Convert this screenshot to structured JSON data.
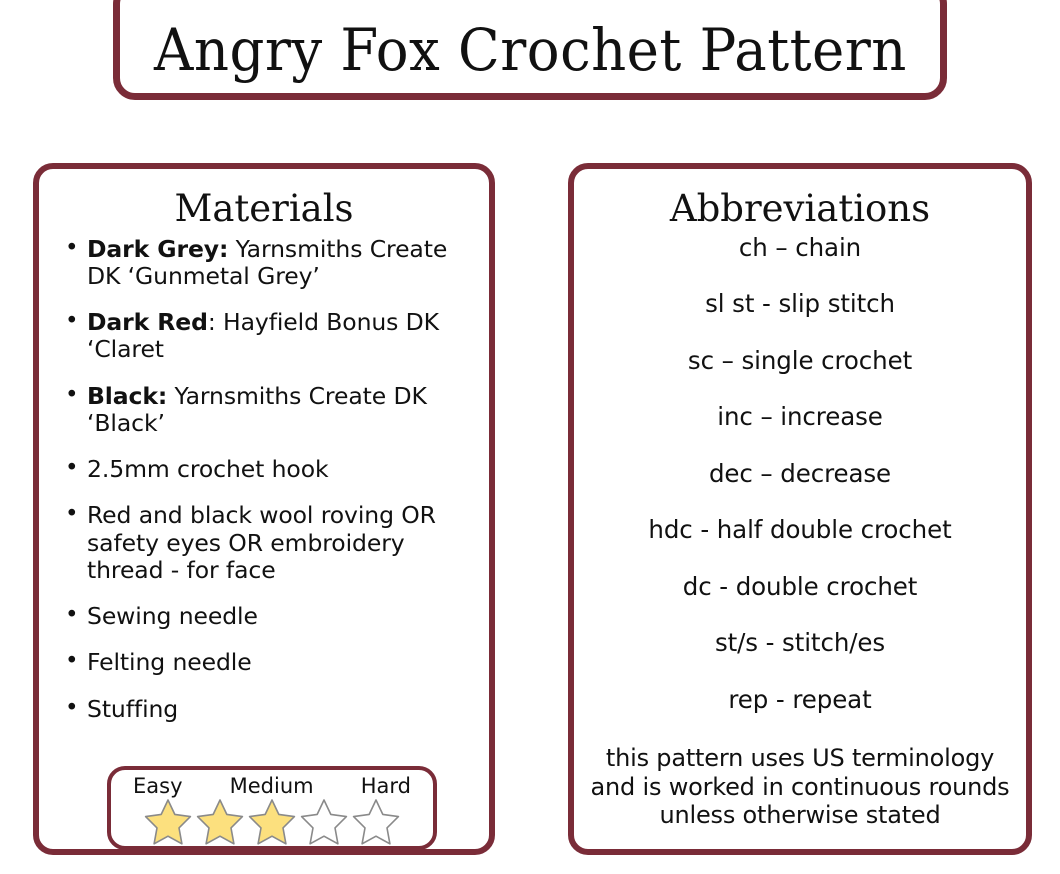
{
  "document": {
    "title": "Angry Fox Crochet Pattern",
    "accent_color": "#7a2c38",
    "text_color": "#111111",
    "background_color": "#ffffff"
  },
  "materials": {
    "heading": "Materials",
    "items": [
      {
        "label": "Dark Grey:",
        "text": " Yarnsmiths Create DK ‘Gunmetal Grey’"
      },
      {
        "label": "Dark Red",
        "text": ": Hayfield Bonus DK ‘Claret"
      },
      {
        "label": "Black:",
        "text": " Yarnsmiths Create DK ‘Black’"
      },
      {
        "label": "",
        "text": "2.5mm crochet hook"
      },
      {
        "label": "",
        "text": "Red and black wool roving OR safety eyes OR embroidery thread - for face"
      },
      {
        "label": "",
        "text": "Sewing needle"
      },
      {
        "label": "",
        "text": "Felting needle"
      },
      {
        "label": "",
        "text": "Stuffing"
      }
    ],
    "difficulty": {
      "labels": {
        "easy": "Easy",
        "medium": "Medium",
        "hard": "Hard"
      },
      "total_stars": 5,
      "filled_stars": 3,
      "star_fill_color": "#fce07e",
      "star_outline_color": "#8a8a8a"
    }
  },
  "abbreviations": {
    "heading": "Abbreviations",
    "entries": [
      "ch – chain",
      "sl st - slip stitch",
      "sc – single crochet",
      "inc – increase",
      "dec – decrease",
      "hdc - half double crochet",
      "dc - double crochet",
      "st/s - stitch/es",
      "rep - repeat"
    ],
    "note": "this pattern uses US terminology and is worked in continuous rounds unless otherwise stated"
  }
}
